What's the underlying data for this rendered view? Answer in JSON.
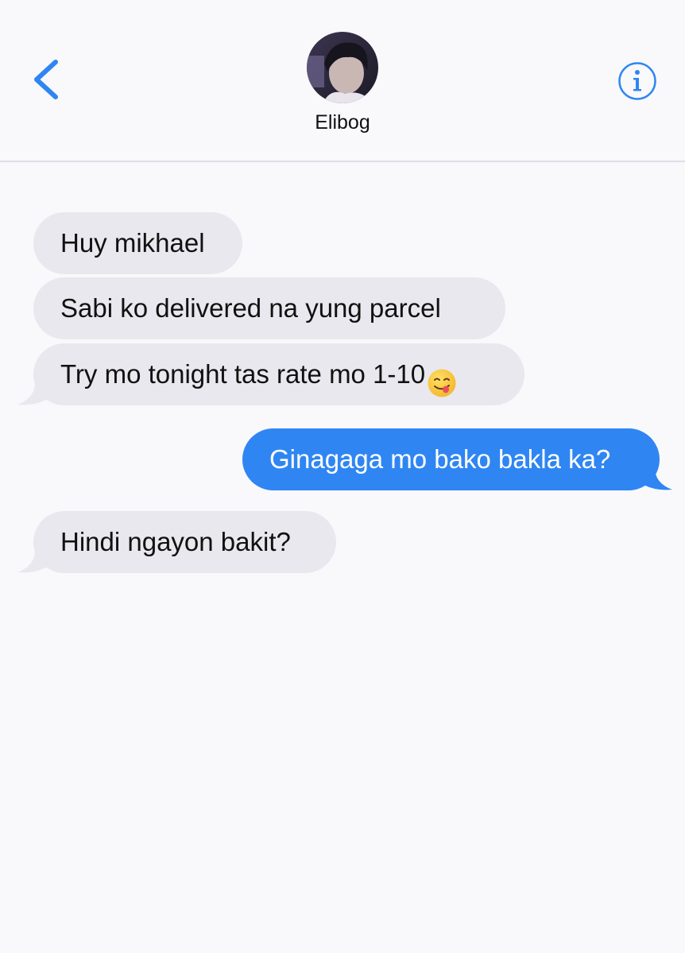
{
  "header": {
    "contact_name": "Elibog",
    "back_icon": "chevron-left-icon",
    "info_icon": "info-circle-icon",
    "accent_color": "#2f86f2"
  },
  "messages": [
    {
      "direction": "incoming",
      "text": "Huy mikhael"
    },
    {
      "direction": "incoming",
      "text": "Sabi ko delivered na yung parcel"
    },
    {
      "direction": "incoming",
      "text": "Try mo tonight tas rate mo 1-10",
      "emoji": "face-savoring-food-emoji"
    },
    {
      "direction": "outgoing",
      "text": "Ginagaga mo bako bakla ka?"
    },
    {
      "direction": "incoming",
      "text": "Hindi ngayon bakit?"
    }
  ],
  "colors": {
    "incoming_bubble": "#e9e8ee",
    "outgoing_bubble": "#2f86f2",
    "background": "#f9f9fb"
  }
}
